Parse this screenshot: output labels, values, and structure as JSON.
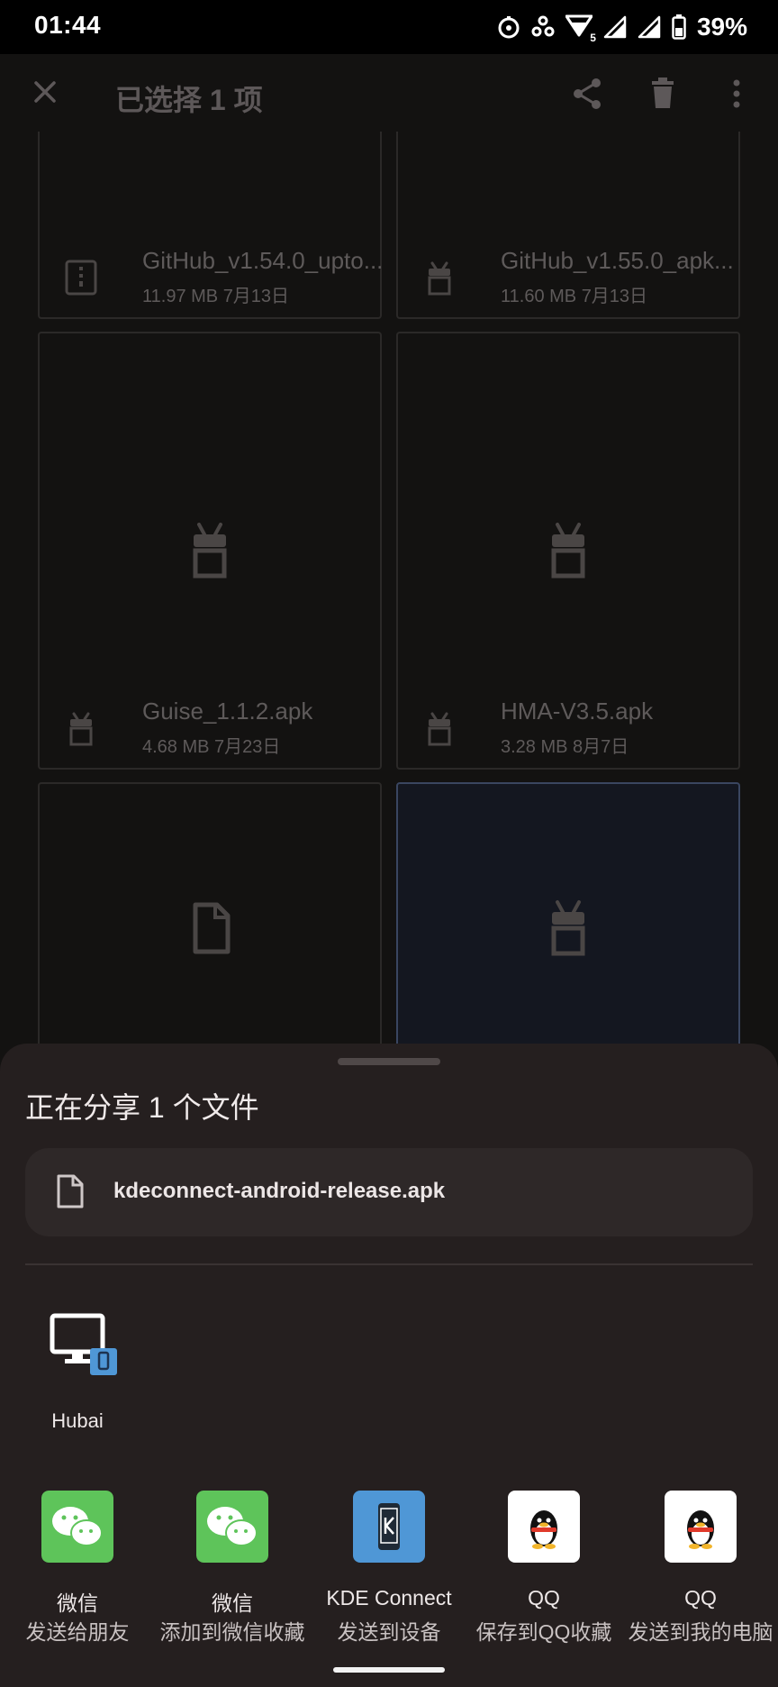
{
  "status_bar": {
    "time": "01:44",
    "network_badge": "5",
    "battery_percent": "39%",
    "icons": [
      "timer-icon",
      "debug-icon",
      "wifi-icon",
      "signal-icon",
      "signal-icon",
      "battery-icon"
    ]
  },
  "toolbar": {
    "title": "已选择 1 项",
    "icons": [
      "close-icon",
      "share-icon",
      "delete-icon",
      "more-vert-icon"
    ]
  },
  "files": [
    {
      "name": "GitHub_v1.54.0_upto...",
      "size": "11.97 MB",
      "date": "7月13日",
      "type": "archive"
    },
    {
      "name": "GitHub_v1.55.0_apk...",
      "size": "11.60 MB",
      "date": "7月13日",
      "type": "apk"
    },
    {
      "name": "Guise_1.1.2.apk",
      "size": "4.68 MB",
      "date": "7月23日",
      "type": "apk"
    },
    {
      "name": "HMA-V3.5.apk",
      "size": "3.28 MB",
      "date": "8月7日",
      "type": "apk"
    }
  ],
  "share_sheet": {
    "title": "正在分享 1 个文件",
    "file_name": "kdeconnect-android-release.apk",
    "direct_targets": [
      {
        "label": "Hubai"
      }
    ],
    "apps": [
      {
        "label": "微信",
        "sub": "发送给朋友"
      },
      {
        "label": "微信",
        "sub": "添加到微信收藏"
      },
      {
        "label": "KDE Connect",
        "sub": "发送到设备"
      },
      {
        "label": "QQ",
        "sub": "保存到QQ收藏"
      },
      {
        "label": "QQ",
        "sub": "发送到我的电脑"
      }
    ]
  },
  "colors": {
    "sheet_bg": "#251f1f",
    "wechat_green": "#5ec45a",
    "kde_blue": "#4f97d6",
    "selected_border": "#3a4660"
  }
}
